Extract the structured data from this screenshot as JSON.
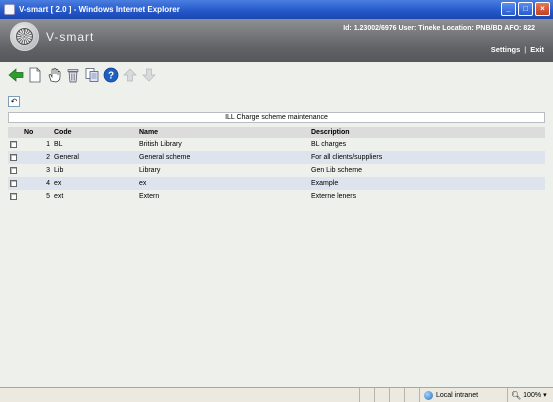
{
  "window": {
    "title": "V-smart [ 2.0 ] - Windows Internet Explorer",
    "min_glyph": "_",
    "max_glyph": "□",
    "close_glyph": "×"
  },
  "header": {
    "brand": "V-smart",
    "user_info": "Id: 1.23002/6976   User: Tineke   Location: PNB/BD   AFO: 822",
    "settings_link": "Settings",
    "separator": "|",
    "exit_link": "Exit"
  },
  "toolbar": {
    "icons": [
      "back-arrow-icon",
      "new-document-icon",
      "hand-select-icon",
      "trash-icon",
      "copy-icon",
      "help-icon",
      "up-arrow-icon",
      "down-arrow-icon"
    ],
    "accent_green": "#2f9e2f",
    "help_blue": "#1f5fbf"
  },
  "refresh_glyph": "↶",
  "panel": {
    "title": "ILL Charge scheme maintenance"
  },
  "table": {
    "columns": [
      "No",
      "Code",
      "Name",
      "Description"
    ],
    "rows": [
      {
        "no": "1",
        "code": "BL",
        "name": "British Library",
        "description": "BL charges"
      },
      {
        "no": "2",
        "code": "General",
        "name": "General scheme",
        "description": "For all clients/suppliers"
      },
      {
        "no": "3",
        "code": "Lib",
        "name": "Library",
        "description": "Gen Lib scheme"
      },
      {
        "no": "4",
        "code": "ex",
        "name": "ex",
        "description": "Example"
      },
      {
        "no": "5",
        "code": "ext",
        "name": "Extern",
        "description": "Externe leners"
      }
    ]
  },
  "statusbar": {
    "zone": "Local intranet",
    "zoom": "100%",
    "zoom_arrow": "▾"
  }
}
